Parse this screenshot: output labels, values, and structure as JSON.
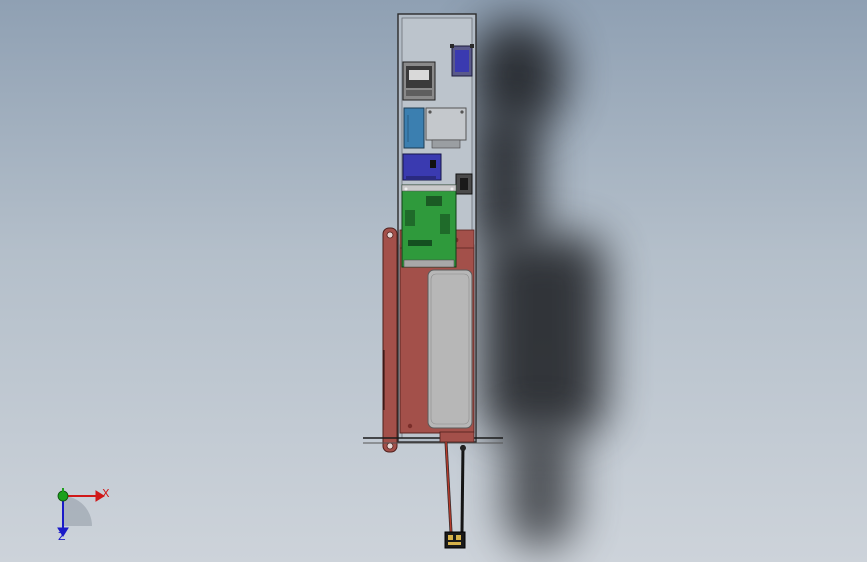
{
  "axes": {
    "x_label": "X",
    "y_label": "Y",
    "z_label": "Z",
    "x_color": "#d01818",
    "y_color": "#1ca01c",
    "z_color": "#1a1ac8"
  },
  "colors": {
    "background_top": "#8fa0b3",
    "background_bottom": "#cdd3da",
    "enclosure": "#b8c0c8",
    "red_panel": "#a3504a",
    "gray_block": "#b7b7b7",
    "pcb_green": "#2f9a3c",
    "module_blue": "#3a3ab0",
    "module_teal": "#3b7fb0",
    "shadow": "#1a1c20"
  }
}
